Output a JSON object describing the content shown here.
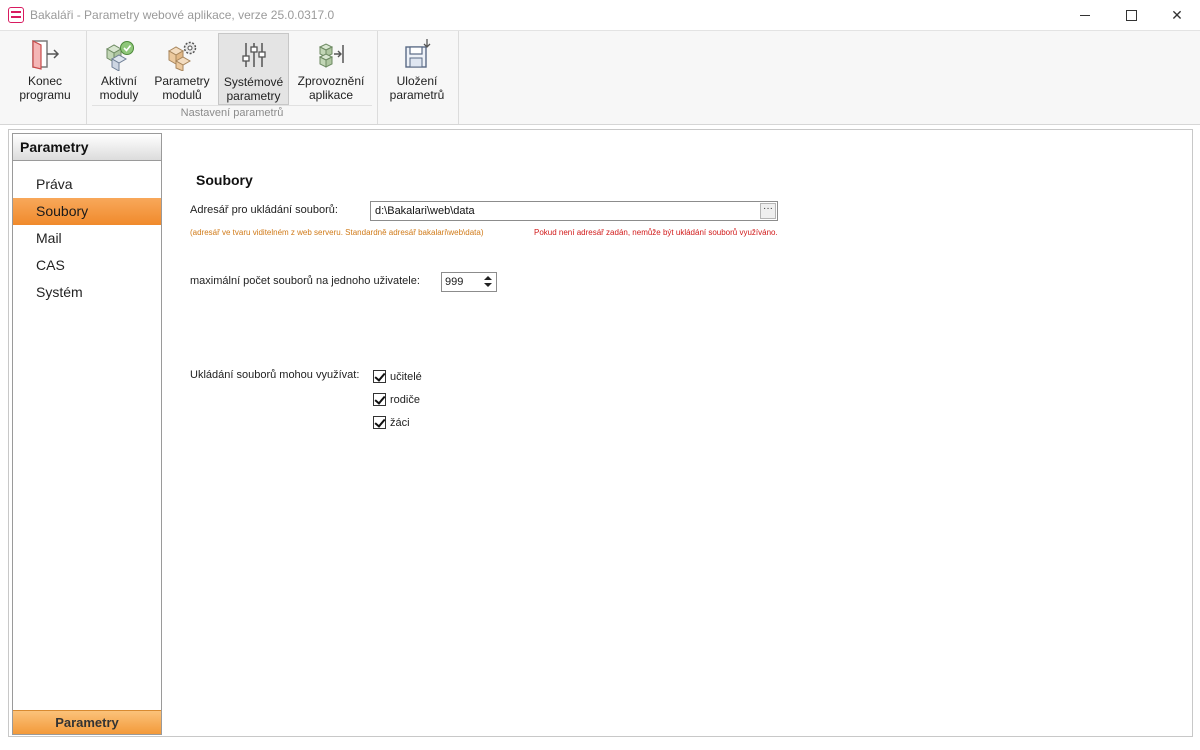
{
  "window": {
    "title": "Bakaláři - Parametry webové aplikace, verze 25.0.0317.0",
    "controls": {
      "minimize_icon": "minimize-icon",
      "maximize_icon": "maximize-icon",
      "close_label": "✕"
    }
  },
  "ribbon": {
    "buttons": [
      {
        "label": "Konec\nprogramu",
        "icon": "exit-door-icon",
        "active": false
      },
      {
        "label": "Aktivní\nmoduly",
        "icon": "active-modules-icon",
        "active": false
      },
      {
        "label": "Parametry\nmodulů",
        "icon": "module-settings-icon",
        "active": false
      },
      {
        "label": "Systémové\nparametry",
        "icon": "sliders-icon",
        "active": true
      },
      {
        "label": "Zprovoznění\naplikace",
        "icon": "deploy-icon",
        "active": false
      },
      {
        "label": "Uložení\nparametrů",
        "icon": "save-icon",
        "active": false
      }
    ],
    "group_label": "Nastavení parametrů"
  },
  "sidebar": {
    "header": "Parametry",
    "items": [
      {
        "label": "Práva",
        "active": false
      },
      {
        "label": "Soubory",
        "active": true
      },
      {
        "label": "Mail",
        "active": false
      },
      {
        "label": "CAS",
        "active": false
      },
      {
        "label": "Systém",
        "active": false
      }
    ],
    "footer": "Parametry"
  },
  "content": {
    "section_title": "Soubory",
    "storage_dir_label": "Adresář pro ukládání souborů:",
    "storage_dir_value": "d:\\Bakalari\\web\\data",
    "browse_label": "···",
    "hint_orange": "(adresář ve tvaru viditelném z web serveru. Standardně adresář bakalari\\web\\data)",
    "hint_red": "Pokud není adresář zadán, nemůže být ukládání souborů využíváno.",
    "max_files_label": "maximální počet souborů na jednoho uživatele:",
    "max_files_value": "999",
    "usage_label": "Ukládání souborů mohou využívat:",
    "checkboxes": [
      {
        "label": "učitelé",
        "checked": true
      },
      {
        "label": "rodiče",
        "checked": true
      },
      {
        "label": "žáci",
        "checked": true
      }
    ]
  },
  "colors": {
    "accent_orange": "#f08a2c",
    "hint_orange": "#d07a18",
    "hint_red": "#d11a1a",
    "app_icon": "#d81b60"
  }
}
